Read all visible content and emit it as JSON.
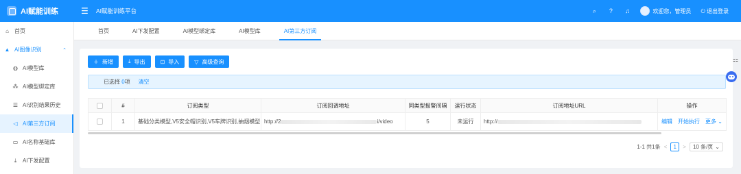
{
  "brand": {
    "title": "AI赋能训练"
  },
  "header": {
    "app_title": "AI赋能训练平台",
    "greeting": "欢迎您，管理员",
    "logout": "退出登录"
  },
  "sidebar": {
    "items": [
      {
        "label": "首页",
        "icon": "home-icon"
      },
      {
        "label": "AI图像识别",
        "icon": "warning-icon"
      },
      {
        "label": "AI模型库",
        "icon": "model-icon"
      },
      {
        "label": "AI模型绑定库",
        "icon": "binding-icon"
      },
      {
        "label": "AI识别结果历史",
        "icon": "list-icon"
      },
      {
        "label": "AI第三方订阅",
        "icon": "speaker-icon"
      },
      {
        "label": "AI名称基础库",
        "icon": "document-icon"
      },
      {
        "label": "AI下发配置",
        "icon": "download-icon"
      }
    ]
  },
  "tabs": [
    "首页",
    "AI下发配置",
    "AI模型绑定库",
    "AI模型库",
    "AI第三方订阅"
  ],
  "toolbar": {
    "add": "新增",
    "export": "导出",
    "import": "导入",
    "advanced": "高级查询"
  },
  "selection": {
    "prefix": "已选择",
    "count": "0",
    "suffix": "项",
    "clear": "清空"
  },
  "table": {
    "headers": [
      "#",
      "订阅类型",
      "订阅回调地址",
      "同类型报警间隔",
      "运行状态",
      "订阅地址URL",
      "操作"
    ],
    "rows": [
      {
        "index": "1",
        "type": "基础分类模型,V5安全帽识别,V5车牌识别,抽烟模型",
        "callback_start": "http://2",
        "callback_end": "i/video",
        "interval": "5",
        "status": "未运行",
        "url_start": "http://",
        "ops": [
          "编辑",
          "开始执行",
          "更多"
        ]
      }
    ]
  },
  "pager": {
    "summary": "1-1 共1条",
    "current": "1",
    "size": "10 条/页"
  },
  "colors": {
    "primary": "#1890ff"
  }
}
